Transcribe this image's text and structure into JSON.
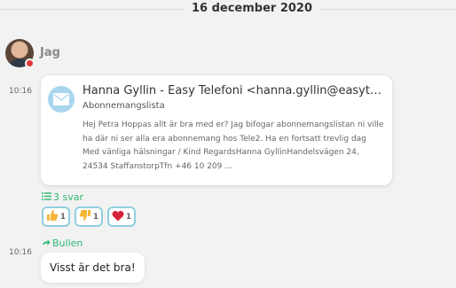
{
  "date_divider": "16 december 2020",
  "sender": {
    "name": "Jag",
    "status_color": "#e03a3a"
  },
  "messages": [
    {
      "time": "10:16",
      "email": {
        "header": "Hanna Gyllin - Easy Telefoni <hanna.gyllin@easytele…",
        "subject": "Abonnemangslista",
        "body": "Hej Petra Hoppas allt är bra med er? Jag bifogar abonnemangslistan ni ville ha där ni ser alla era abonnemang hos Tele2. Ha en fortsatt trevlig dag Med vänliga hälsningar / Kind RegardsHanna GyllinHandelsvägen 24, 24534 StaffanstorpTfn +46 10 209 ..."
      },
      "replies_label": "3 svar",
      "reactions": [
        {
          "icon": "thumbs-up-icon",
          "count": "1"
        },
        {
          "icon": "thumbs-down-icon",
          "count": "1"
        },
        {
          "icon": "heart-icon",
          "count": "1"
        }
      ]
    },
    {
      "time": "10:16",
      "forward_label": "Bullen",
      "text": "Visst är det bra!"
    }
  ],
  "colors": {
    "accent_green": "#2eb872",
    "reaction_border": "#8fd0e0",
    "mail_icon_bg": "#a9d6ee"
  }
}
